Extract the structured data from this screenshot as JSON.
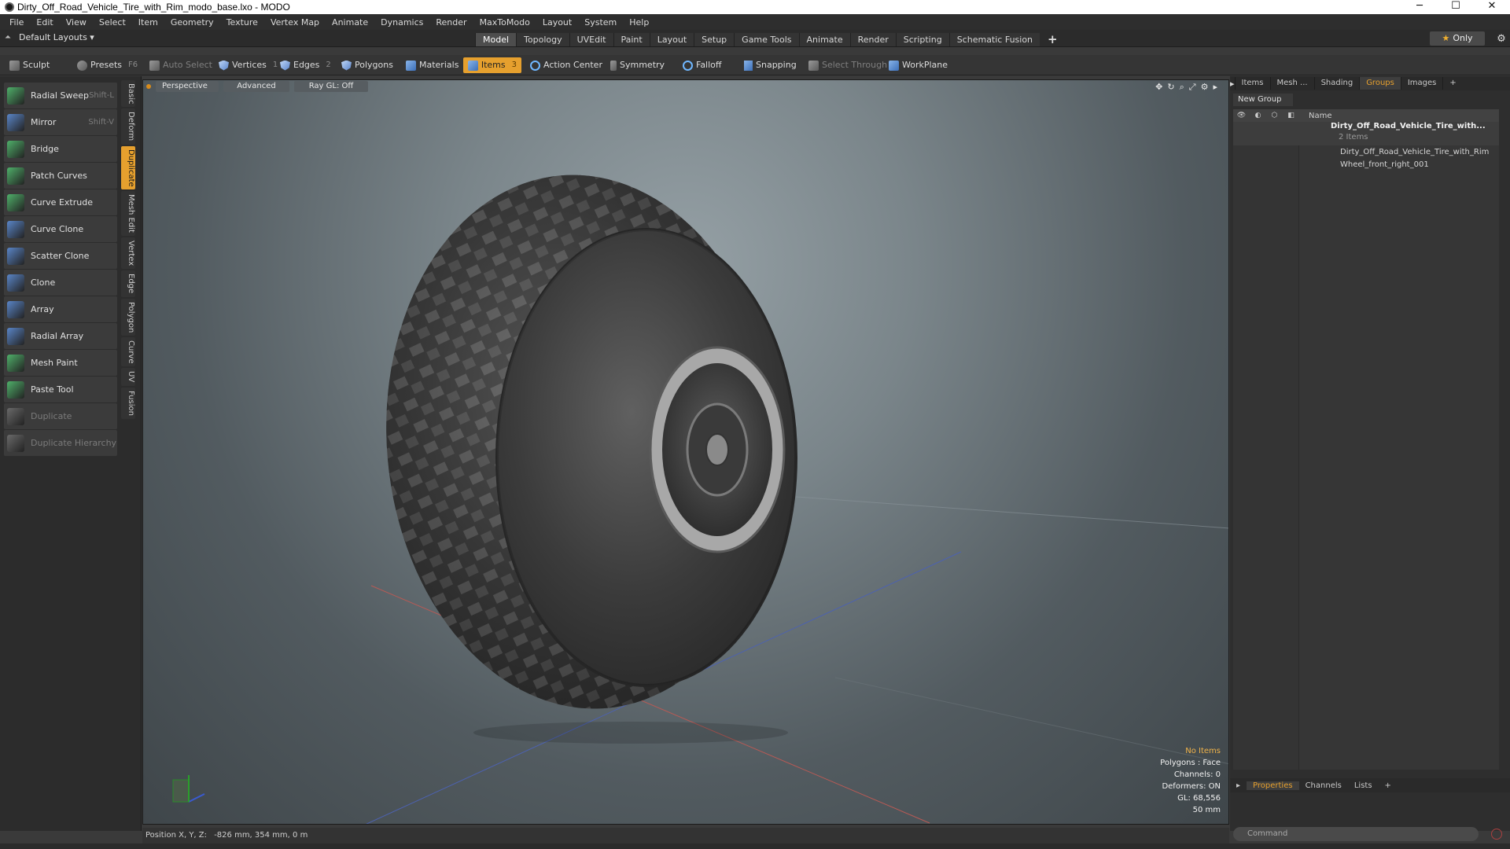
{
  "window": {
    "title": "Dirty_Off_Road_Vehicle_Tire_with_Rim_modo_base.lxo - MODO",
    "minimize": "─",
    "maximize": "☐",
    "close": "✕"
  },
  "menu": [
    "File",
    "Edit",
    "View",
    "Select",
    "Item",
    "Geometry",
    "Texture",
    "Vertex Map",
    "Animate",
    "Dynamics",
    "Render",
    "MaxToModo",
    "Layout",
    "System",
    "Help"
  ],
  "layout_bar": {
    "layout_dropdown": "Default Layouts ▾",
    "tabs": [
      "Model",
      "Topology",
      "UVEdit",
      "Paint",
      "Layout",
      "Setup",
      "Game Tools",
      "Animate",
      "Render",
      "Scripting",
      "Schematic Fusion"
    ],
    "active_tab": "Model",
    "plus": "+",
    "only_label": "Only"
  },
  "toolbar": {
    "sculpt": "Sculpt",
    "presets": "Presets",
    "presets_key": "F6",
    "auto_select": "Auto Select",
    "vertices": "Vertices",
    "vertices_count": "1",
    "edges": "Edges",
    "edges_count": "2",
    "polygons": "Polygons",
    "materials": "Materials",
    "items": "Items",
    "items_count": "3",
    "action_center": "Action Center",
    "symmetry": "Symmetry",
    "falloff": "Falloff",
    "snapping": "Snapping",
    "select_through": "Select Through",
    "workplane": "WorkPlane"
  },
  "tools": [
    {
      "label": "Radial Sweep",
      "shortcut": "Shift-L",
      "icon": "radial-sweep-icon",
      "color": "#4fb06a"
    },
    {
      "label": "Mirror",
      "shortcut": "Shift-V",
      "icon": "mirror-icon",
      "color": "#5a86c8"
    },
    {
      "label": "Bridge",
      "shortcut": "",
      "icon": "bridge-icon",
      "color": "#4fb06a"
    },
    {
      "label": "Patch Curves",
      "shortcut": "",
      "icon": "patch-curves-icon",
      "color": "#4fb06a"
    },
    {
      "label": "Curve Extrude",
      "shortcut": "",
      "icon": "curve-extrude-icon",
      "color": "#4fb06a"
    },
    {
      "label": "Curve Clone",
      "shortcut": "",
      "icon": "curve-clone-icon",
      "color": "#5a86c8"
    },
    {
      "label": "Scatter Clone",
      "shortcut": "",
      "icon": "scatter-clone-icon",
      "color": "#5a86c8"
    },
    {
      "label": "Clone",
      "shortcut": "",
      "icon": "clone-icon",
      "color": "#5a86c8"
    },
    {
      "label": "Array",
      "shortcut": "",
      "icon": "array-icon",
      "color": "#5a86c8"
    },
    {
      "label": "Radial Array",
      "shortcut": "",
      "icon": "radial-array-icon",
      "color": "#5a86c8"
    },
    {
      "label": "Mesh Paint",
      "shortcut": "",
      "icon": "mesh-paint-icon",
      "color": "#4fb06a"
    },
    {
      "label": "Paste Tool",
      "shortcut": "",
      "icon": "paste-tool-icon",
      "color": "#4fb06a"
    },
    {
      "label": "Duplicate",
      "shortcut": "",
      "icon": "duplicate-icon",
      "color": "#6a6a6a"
    },
    {
      "label": "Duplicate Hierarchy",
      "shortcut": "",
      "icon": "duplicate-hierarchy-icon",
      "color": "#6a6a6a"
    }
  ],
  "vertical_tabs": [
    "Basic",
    "Deform",
    "Duplicate",
    "Mesh Edit",
    "Vertex",
    "Edge",
    "Polygon",
    "Curve",
    "UV",
    "Fusion"
  ],
  "vertical_tab_active": "Duplicate",
  "viewport": {
    "perspective": "Perspective",
    "advanced": "Advanced",
    "raygl": "Ray GL: Off",
    "info": [
      "No Items",
      "Polygons : Face",
      "Channels: 0",
      "Deformers: ON",
      "GL: 68,556",
      "50 mm"
    ]
  },
  "right_panel": {
    "tabs": [
      "Items",
      "Mesh ...",
      "Shading",
      "Groups",
      "Images"
    ],
    "active_tab": "Groups",
    "plus": "+",
    "new_group": "New Group",
    "col_name": "Name",
    "group_name": "Dirty_Off_Road_Vehicle_Tire_with...",
    "group_count": "2 Items",
    "children": [
      "Dirty_Off_Road_Vehicle_Tire_with_Rim",
      "Wheel_front_right_001"
    ],
    "bottom_tabs": [
      "Properties",
      "Channels",
      "Lists"
    ],
    "bottom_active": "Properties",
    "command_placeholder": "Command"
  },
  "status": {
    "position_label": "Position X, Y, Z:",
    "position_value": "-826 mm, 354 mm, 0 m"
  }
}
